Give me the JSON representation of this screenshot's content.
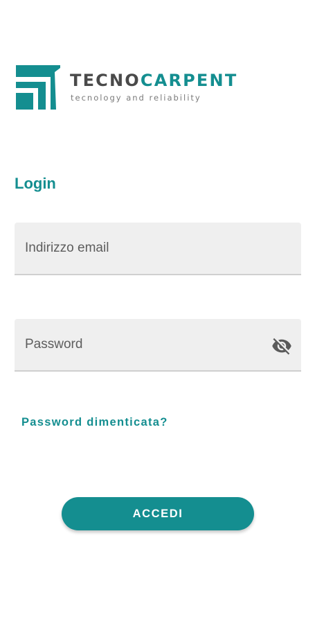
{
  "logo": {
    "brand_part1": "TECNO",
    "brand_part2": "CARPENT",
    "tagline": "tecnology and reliability",
    "icon": "tecnocarpent-logo-mark"
  },
  "login": {
    "title": "Login",
    "email_placeholder": "Indirizzo email",
    "password_placeholder": "Password",
    "password_toggle_icon": "eye-off-icon",
    "forgot_password": "Password dimenticata?",
    "submit_label": "ACCEDI"
  },
  "colors": {
    "accent": "#148e90",
    "brand_dark": "#4a4a4a",
    "field_background": "#efefef",
    "field_underline": "#cfcfcf",
    "background": "#ffffff"
  }
}
